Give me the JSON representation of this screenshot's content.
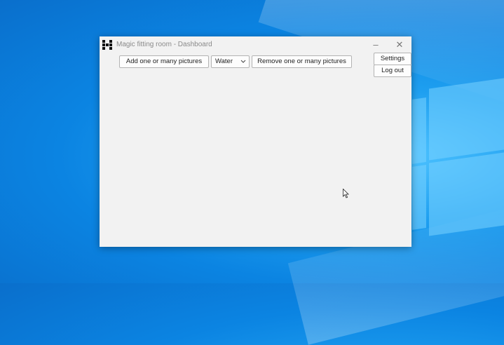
{
  "window": {
    "title": "Magic fitting room - Dashboard",
    "minimize_glyph": "–",
    "close_glyph": "✕"
  },
  "toolbar": {
    "add_label": "Add one or many pictures",
    "category_value": "Water",
    "remove_label": "Remove one or many pictures",
    "settings_label": "Settings",
    "logout_label": "Log out"
  },
  "icons": {
    "app_logo": "app-logo-icon",
    "dropdown": "chevron-down-icon",
    "cursor": "mouse-pointer-icon"
  }
}
